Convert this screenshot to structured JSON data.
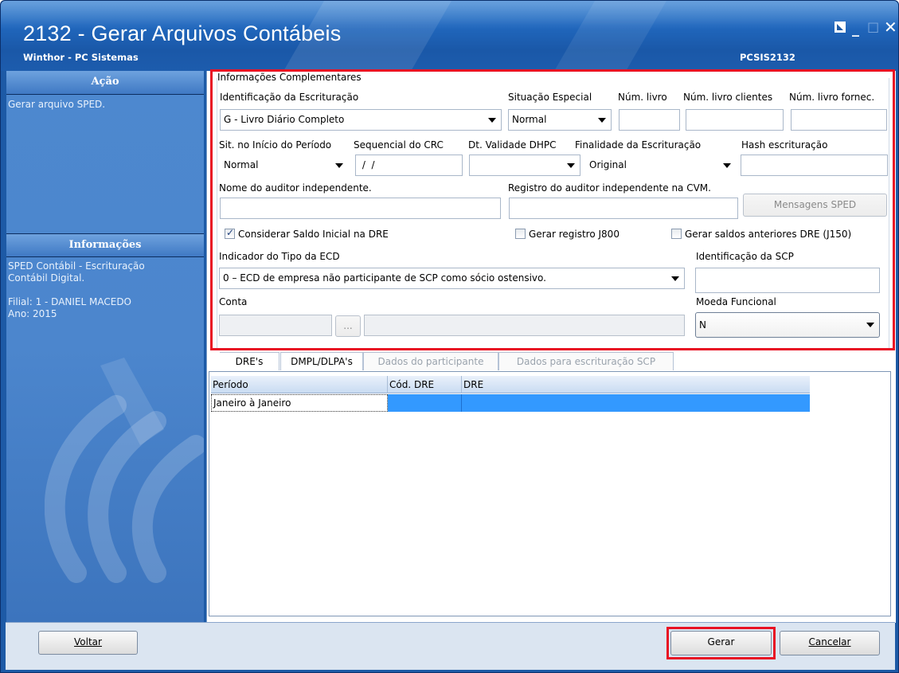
{
  "window": {
    "title": "2132 - Gerar Arquivos Contábeis",
    "subtitle": "Winthor - PC Sistemas",
    "routine_code": "PCSIS2132"
  },
  "sidebar": {
    "acao_header": "Ação",
    "acao_text": "Gerar arquivo SPED.",
    "info_header": "Informações",
    "info_line1": "SPED Contábil - Escrituração",
    "info_line2": "Contábil Digital.",
    "info_filial": "Filial: 1 - DANIEL MACEDO",
    "info_ano": "Ano: 2015"
  },
  "form": {
    "group_title": "Informações Complementares",
    "identificacao_label": "Identificação da Escrituração",
    "identificacao_value": "G - Livro Diário Completo",
    "situacao_label": "Situação Especial",
    "situacao_value": "Normal",
    "num_livro_label": "Núm. livro",
    "num_livro_value": "",
    "num_livro_clientes_label": "Núm. livro clientes",
    "num_livro_clientes_value": "",
    "num_livro_fornec_label": "Núm. livro fornec.",
    "num_livro_fornec_value": "",
    "sit_inicio_label": "Sit. no Início do Período",
    "sit_inicio_value": "Normal",
    "sequencial_crc_label": "Sequencial do CRC",
    "sequencial_crc_value": " /  /",
    "dt_validade_label": "Dt. Validade DHPC",
    "dt_validade_value": "",
    "finalidade_label": "Finalidade da Escrituração",
    "finalidade_value": "Original",
    "hash_label": "Hash escrituração",
    "hash_value": "",
    "auditor_label": "Nome do auditor independente.",
    "auditor_value": "",
    "registro_auditor_label": "Registro do auditor independente na CVM.",
    "registro_auditor_value": "",
    "mensagens_button": "Mensagens SPED",
    "chk_saldo_inicial": "Considerar Saldo Inicial na DRE",
    "chk_j800": "Gerar registro J800",
    "chk_j150": "Gerar saldos anteriores DRE (J150)",
    "indicador_label": "Indicador do Tipo da ECD",
    "indicador_value": "0 – ECD de empresa não participante de SCP como sócio ostensivo.",
    "identificacao_scp_label": "Identificação da SCP",
    "identificacao_scp_value": "",
    "conta_label": "Conta",
    "conta_ellipsis": "...",
    "moeda_label": "Moeda Funcional",
    "moeda_value": "N"
  },
  "tabs": [
    "DRE's",
    "DMPL/DLPA's",
    "Dados do participante",
    "Dados para escrituração SCP"
  ],
  "grid": {
    "headers": [
      "Período",
      "Cód. DRE",
      "DRE"
    ],
    "rows": [
      {
        "periodo": "Janeiro à Janeiro",
        "cod": "",
        "dre": ""
      }
    ]
  },
  "footer": {
    "voltar": "Voltar",
    "gerar": "Gerar",
    "cancelar": "Cancelar"
  },
  "colors": {
    "title_bar": "#1d5aa6",
    "sidebar": "#4c86cd",
    "highlight_frame": "#e81123",
    "grid_selection": "#3399ff"
  }
}
